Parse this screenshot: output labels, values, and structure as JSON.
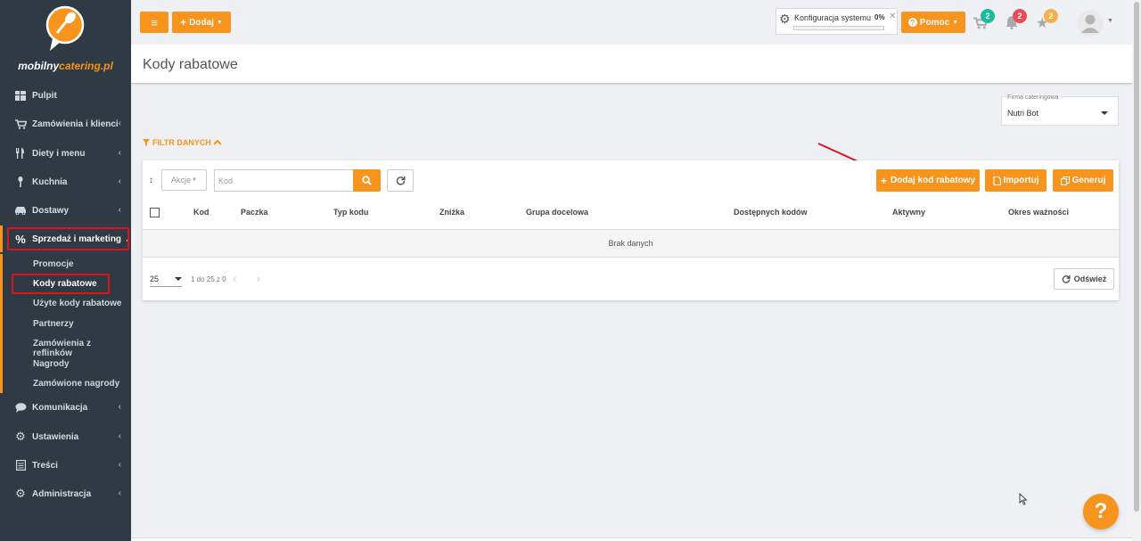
{
  "brand": {
    "name_part1": "mobilny",
    "name_part2": "catering.pl"
  },
  "sidebar": {
    "items": [
      {
        "label": "Pulpit",
        "icon": "dashboard-icon"
      },
      {
        "label": "Zamówienia i klienci",
        "icon": "cart-icon"
      },
      {
        "label": "Diety i menu",
        "icon": "cutlery-icon"
      },
      {
        "label": "Kuchnia",
        "icon": "kitchen-icon"
      },
      {
        "label": "Dostawy",
        "icon": "car-icon"
      },
      {
        "label": "Sprzedaż i marketing",
        "icon": "percent-icon"
      },
      {
        "label": "Komunikacja",
        "icon": "chat-icon"
      },
      {
        "label": "Ustawienia",
        "icon": "gear-icon"
      },
      {
        "label": "Treści",
        "icon": "document-icon"
      },
      {
        "label": "Administracja",
        "icon": "admin-gear-icon"
      }
    ],
    "submenu": [
      {
        "label": "Promocje"
      },
      {
        "label": "Kody rabatowe"
      },
      {
        "label": "Użyte kody rabatowe"
      },
      {
        "label": "Partnerzy"
      },
      {
        "label": "Zamówienia z reflinków"
      },
      {
        "label": "Nagrody"
      },
      {
        "label": "Zamówione nagrody"
      }
    ]
  },
  "topbar": {
    "add_label": "Dodaj",
    "config_label": "Konfiguracja systemu",
    "config_percent": "0%",
    "config_progress": 0,
    "help_label": "Pomoc",
    "cart_count": "2",
    "notif_count": "2",
    "star_count": "2"
  },
  "page": {
    "title": "Kody rabatowe",
    "firm_label": "Firma cateringowa",
    "firm_value": "Nutri Bot",
    "filter_label": "FILTR DANYCH"
  },
  "toolbar": {
    "actions_label": "Akcje",
    "search_placeholder": "Kod",
    "add_code_label": "Dodaj kod rabatowy",
    "import_label": "Importuj",
    "generate_label": "Generuj"
  },
  "table": {
    "columns": [
      "Kod",
      "Paczka",
      "Typ kodu",
      "Zniżka",
      "Grupa docelowa",
      "Dostępnych kodów",
      "Aktywny",
      "Okres ważności"
    ],
    "empty_text": "Brak danych"
  },
  "pagination": {
    "page_size": "25",
    "range_text": "1 do 25 z 0",
    "refresh_label": "Odśwież"
  },
  "colors": {
    "accent": "#f7941d",
    "sidebar": "#2f3a45",
    "highlight": "#e0131c"
  }
}
